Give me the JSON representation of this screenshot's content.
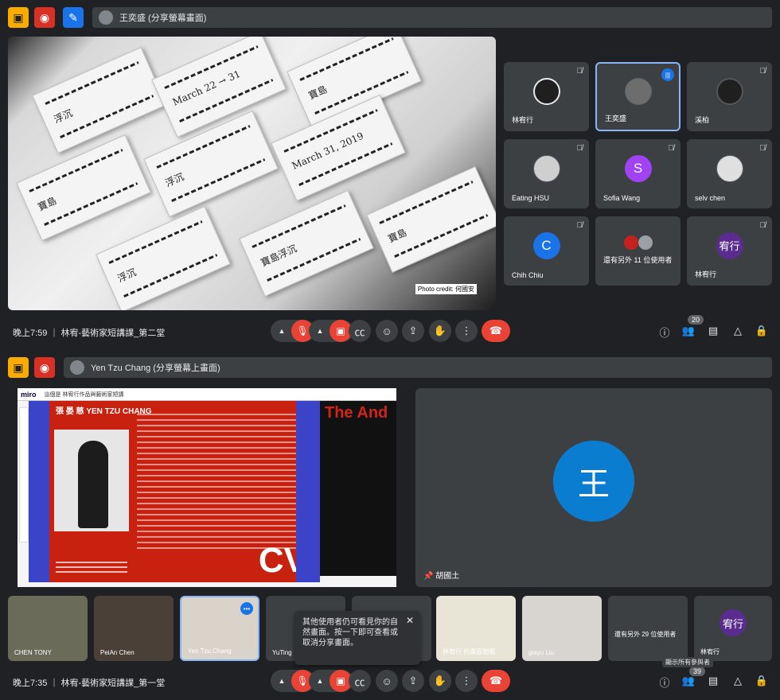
{
  "window1": {
    "presenter_label": "王奕盛 (分享螢幕畫面)",
    "photo_credit": "Photo credit: 何國安",
    "participants": [
      {
        "name": "林宥行",
        "avatar": ""
      },
      {
        "name": "王奕盛",
        "avatar": ""
      },
      {
        "name": "溪柏",
        "avatar": ""
      },
      {
        "name": "Eating HSU",
        "avatar": ""
      },
      {
        "name": "Sofia Wang",
        "avatar": "S"
      },
      {
        "name": "selv chen",
        "avatar": ""
      },
      {
        "name": "Chih Chiu",
        "avatar": "C"
      },
      {
        "name": "還有另外 11 位使用者",
        "avatar": ""
      },
      {
        "name": "林宥行",
        "avatar": "宥行"
      }
    ],
    "meeting_info": "晚上7:59 ｜ 林宥-藝術家短講課_第二堂",
    "people_count": "20",
    "colors": {
      "sofia": "#a142f4",
      "chih": "#1a73e8",
      "lin": "#5b2c8f"
    }
  },
  "window2": {
    "presenter_label": "Yen Tzu Chang (分享螢幕上畫面)",
    "miro": {
      "logo": "miro",
      "board_title": "這個是 林宥行作品與藝術家短講",
      "cv_name": "張 晏 慈  YEN TZU CHANG",
      "cv_big": "CV",
      "the_and": "The And"
    },
    "pinned_name": "胡國土",
    "pinned_avatar": "王",
    "strip": [
      {
        "name": "CHEN TONY"
      },
      {
        "name": "PeiAn Chen"
      },
      {
        "name": "Yen Tzu Chang"
      },
      {
        "name": "YuTing"
      },
      {
        "name": ""
      },
      {
        "name": "林宥行 的畫面簡報"
      },
      {
        "name": "giayu Liu"
      },
      {
        "name": "還有另外 29 位使用者"
      },
      {
        "name": "林宥行",
        "avatar": "宥行"
      }
    ],
    "toast": "其他使用者仍可看見你的自然畫面。按一下即可查看或取消分享畫面。",
    "tooltip": "顯示所有參與者",
    "meeting_info": "晚上7:35 ｜ 林宥-藝術家短講課_第一堂",
    "people_count": "39"
  }
}
